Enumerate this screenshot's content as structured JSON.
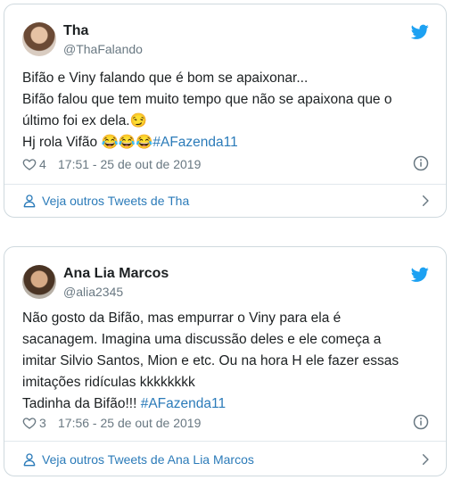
{
  "tweets": [
    {
      "name": "Tha",
      "handle": "@ThaFalando",
      "lines": [
        "Bifão e Viny falando que é bom se apaixonar...",
        "Bifão falou que tem muito tempo que não se apaixona que o",
        "último foi ex dela.😏",
        "Hj rola Vifão 😂😂😂"
      ],
      "hashtag": "#AFazenda11",
      "likes": "4",
      "time": "17:51 - 25 de out de 2019",
      "more": "Veja outros Tweets de Tha"
    },
    {
      "name": "Ana Lia Marcos",
      "handle": "@alia2345",
      "lines": [
        "Não gosto da Bifão, mas empurrar o Viny para ela é",
        "sacanagem. Imagina uma discussão deles e ele começa a",
        "imitar Silvio Santos, Mion e etc. Ou na hora H ele fazer essas",
        "imitações ridículas kkkkkkkk",
        "Tadinha da Bifão!!! "
      ],
      "hashtag": "#AFazenda11",
      "likes": "3",
      "time": "17:56 - 25 de out de 2019",
      "more": "Veja outros Tweets de Ana Lia Marcos"
    }
  ],
  "icons": {
    "bird": "twitter-bird-icon",
    "heart": "heart-icon",
    "info": "info-icon",
    "person": "person-icon",
    "chevron": "chevron-right-icon"
  },
  "colors": {
    "twitter_blue": "#1da1f2",
    "link_blue": "#2b7bb9",
    "muted": "#697882",
    "border": "#cfd9de"
  }
}
